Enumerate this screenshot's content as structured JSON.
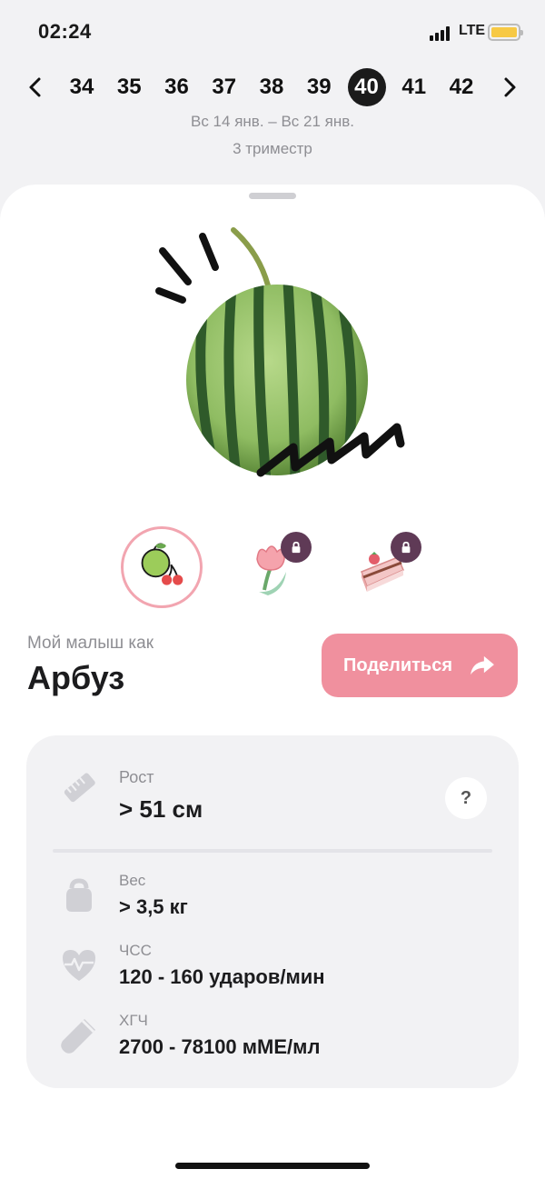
{
  "status_bar": {
    "time": "02:24",
    "network": "LTE",
    "battery_color": "#f7c945"
  },
  "week_nav": {
    "weeks": [
      "34",
      "35",
      "36",
      "37",
      "38",
      "39",
      "40",
      "41",
      "42"
    ],
    "active_week": "40",
    "date_range": "Вс 14 янв. – Вс 21 янв.",
    "trimester": "3 триместр"
  },
  "comparison": {
    "subtitle": "Мой малыш как",
    "name": "Арбуз",
    "share_label": "Поделиться",
    "options": [
      {
        "icon": "apple-cherry-icon",
        "locked": false
      },
      {
        "icon": "tulip-icon",
        "locked": true
      },
      {
        "icon": "cake-icon",
        "locked": true
      }
    ]
  },
  "stats": {
    "height_label": "Рост",
    "height_value": "> 51 см",
    "help": "?",
    "weight_label": "Вес",
    "weight_value": "> 3,5 кг",
    "hr_label": "ЧСС",
    "hr_value": "120 - 160 ударов/мин",
    "hcg_label": "ХГЧ",
    "hcg_value": "2700 - 78100 мМЕ/мл"
  },
  "colors": {
    "accent": "#f0909e",
    "lock": "#5f3a56",
    "active_week": "#1b1b1b"
  }
}
